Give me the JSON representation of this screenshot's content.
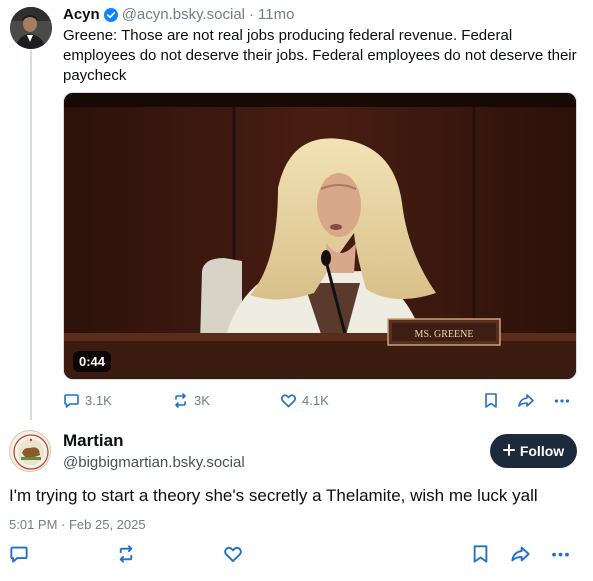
{
  "parent_post": {
    "author_name": "Acyn",
    "handle": "@acyn.bsky.social",
    "separator": "·",
    "age": "11mo",
    "text": "Greene: Those are not real jobs producing federal revenue. Federal employees do not deserve their jobs. Federal employees do not deserve their paycheck",
    "video": {
      "duration": "0:44",
      "nameplate": "MS. GREENE"
    },
    "stats": {
      "replies": "3.1K",
      "reposts": "3K",
      "likes": "4.1K"
    }
  },
  "reply_post": {
    "author_name": "Martian",
    "handle": "@bigbigmartian.bsky.social",
    "follow_label": "Follow",
    "text": "I'm trying to start a theory she's secretly a Thelamite, wish me luck yall",
    "timestamp": "5:01 PM · Feb 25, 2025"
  },
  "colors": {
    "accent": "#1083fe",
    "muted": "#6f7e8c",
    "follow_bg": "#1c2a3b",
    "icon_blue": "#1f70c8"
  },
  "icons": [
    "verified-badge-icon",
    "reply-icon",
    "repost-icon",
    "like-icon",
    "bookmark-icon",
    "share-icon",
    "more-icon",
    "plus-icon"
  ]
}
